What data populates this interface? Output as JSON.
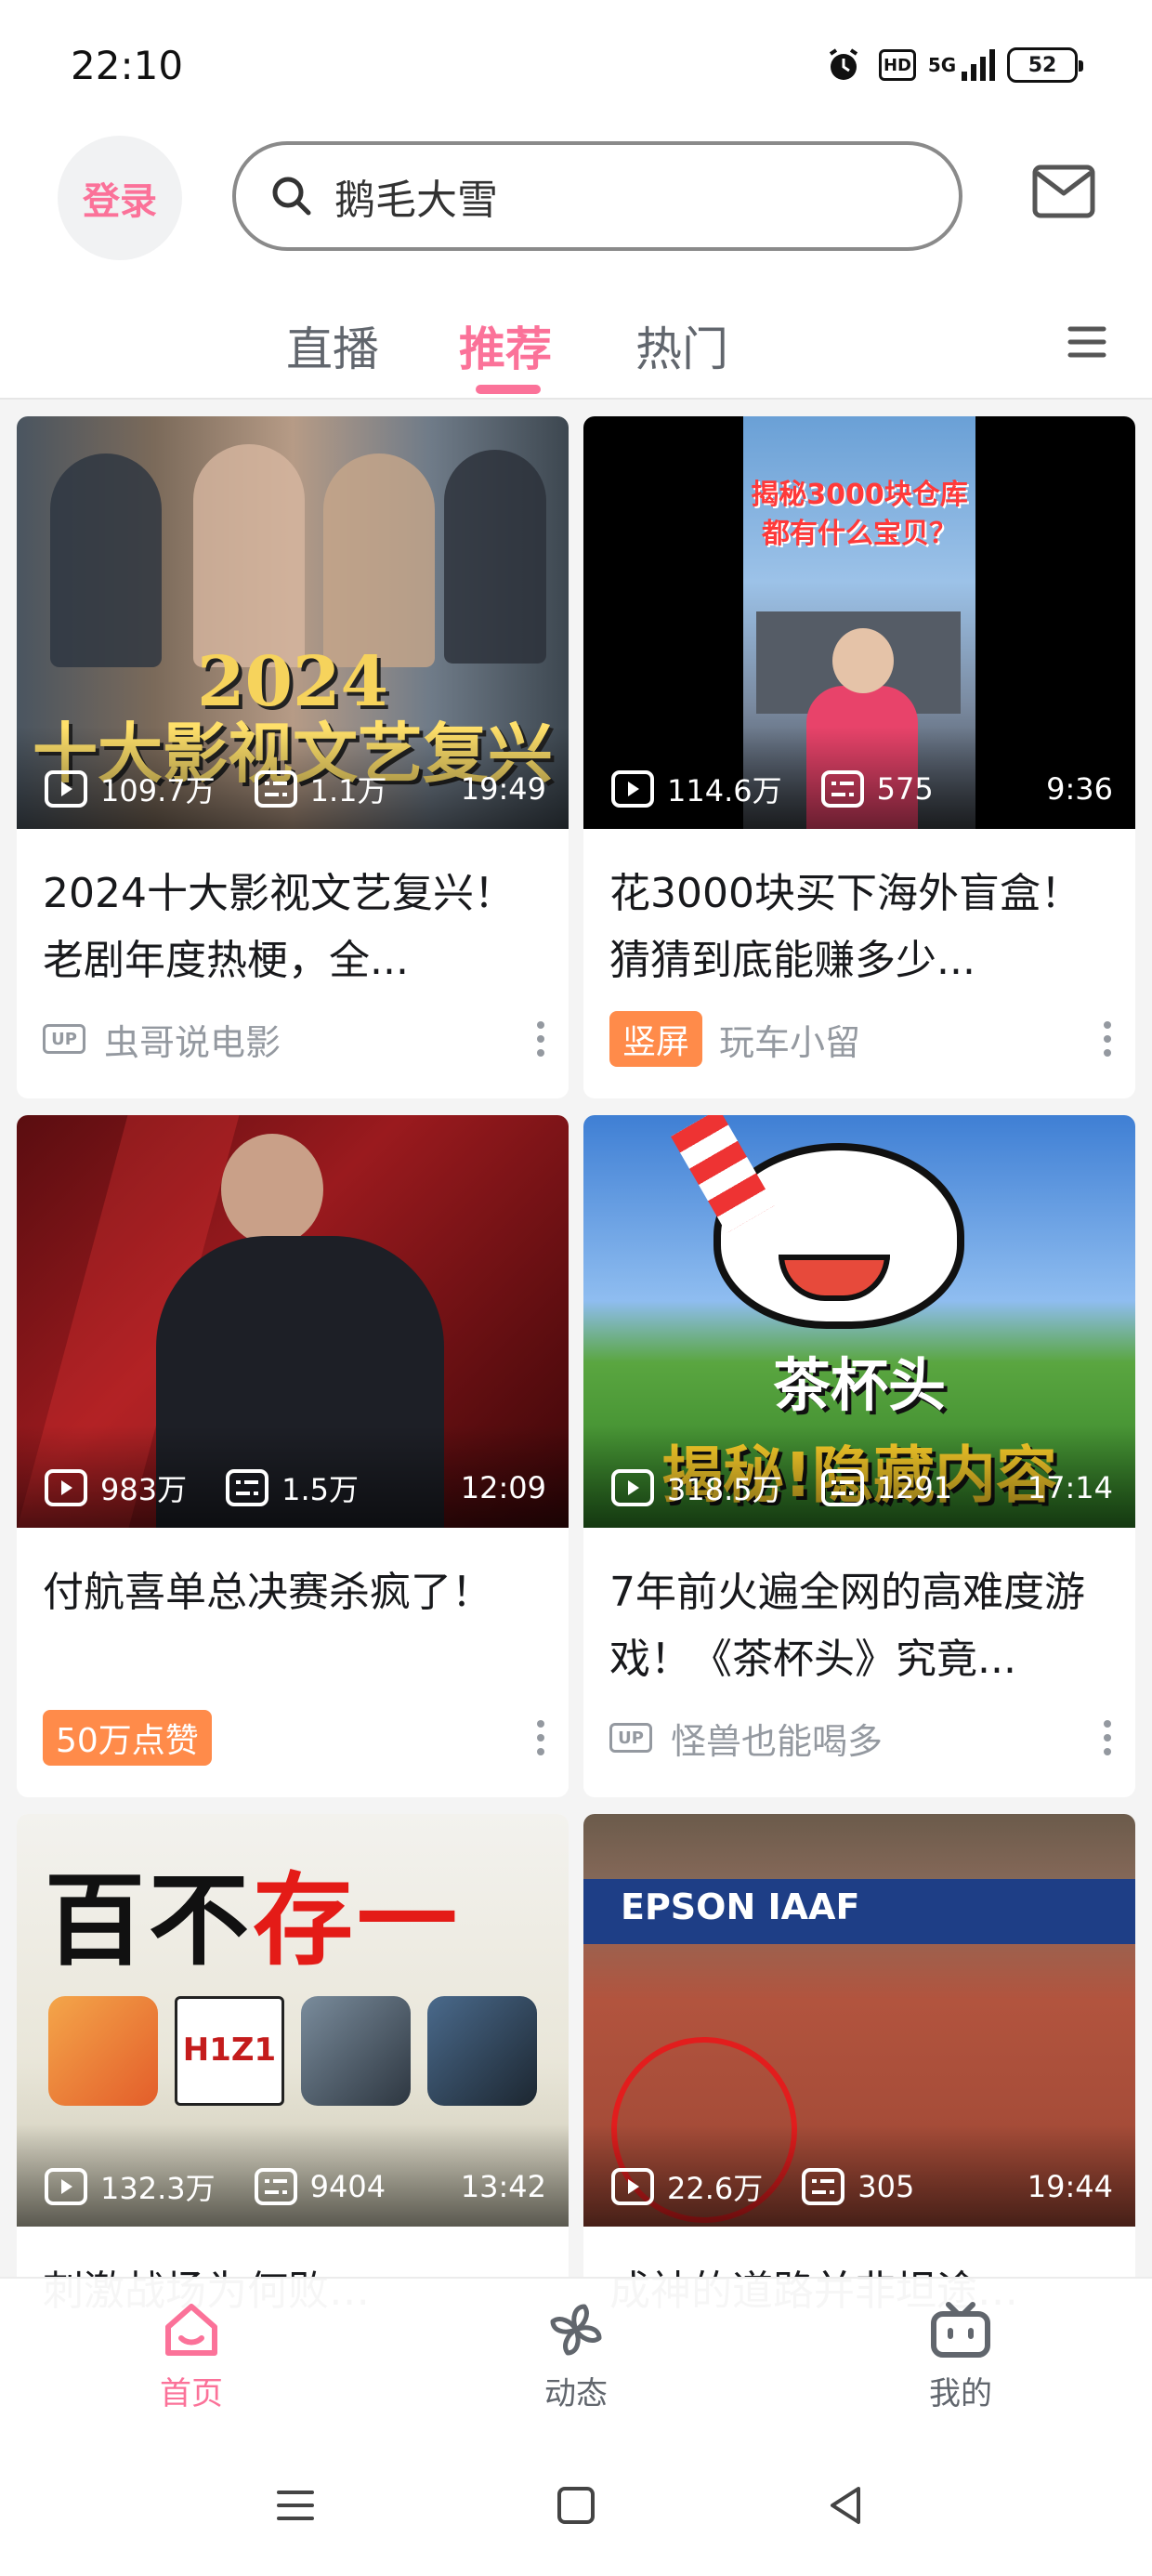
{
  "status": {
    "time": "22:10",
    "network": "5G",
    "hd": "HD",
    "battery": "52"
  },
  "header": {
    "login_label": "登录",
    "search_placeholder": "鹅毛大雪",
    "icons": {
      "search": "search-icon",
      "mail": "mail-icon",
      "menu": "menu-icon"
    }
  },
  "tabs": [
    {
      "label": "直播",
      "active": false
    },
    {
      "label": "推荐",
      "active": true
    },
    {
      "label": "热门",
      "active": false
    }
  ],
  "cards": [
    {
      "views": "109.7万",
      "danmaku": "1.1万",
      "duration": "19:49",
      "title": "2024十大影视文艺复兴！老剧年度热梗，全...",
      "author": "虫哥说电影",
      "tag": "",
      "thumb_text": "2024\n十大影视文艺复兴"
    },
    {
      "views": "114.6万",
      "danmaku": "575",
      "duration": "9:36",
      "title": "花3000块买下海外盲盒！猜猜到底能赚多少...",
      "author": "玩车小留",
      "tag": "竖屏",
      "thumb_text": "揭秘3000块仓库\n都有什么宝贝？"
    },
    {
      "views": "983万",
      "danmaku": "1.5万",
      "duration": "12:09",
      "title": "付航喜单总决赛杀疯了！",
      "author": "",
      "tag": "50万点赞",
      "thumb_text": ""
    },
    {
      "views": "318.5万",
      "danmaku": "1291",
      "duration": "17:14",
      "title": "7年前火遍全网的高难度游戏！《茶杯头》究竟...",
      "author": "怪兽也能喝多",
      "tag": "",
      "thumb_text": "茶杯头\n揭秘！隐藏内容"
    },
    {
      "views": "132.3万",
      "danmaku": "9404",
      "duration": "13:42",
      "title": "刺激战场为何败…",
      "author": "",
      "tag": "",
      "thumb_text": "百不存一"
    },
    {
      "views": "22.6万",
      "danmaku": "305",
      "duration": "19:44",
      "title": "成神的道路并非坦途…",
      "author": "",
      "tag": "",
      "thumb_text": "EPSON  IAAF"
    }
  ],
  "bottom_nav": [
    {
      "label": "首页",
      "active": true
    },
    {
      "label": "动态",
      "active": false
    },
    {
      "label": "我的",
      "active": false
    }
  ],
  "colors": {
    "accent": "#fb7299",
    "tag_orange": "#ff8b4a",
    "muted": "#9499a0"
  }
}
